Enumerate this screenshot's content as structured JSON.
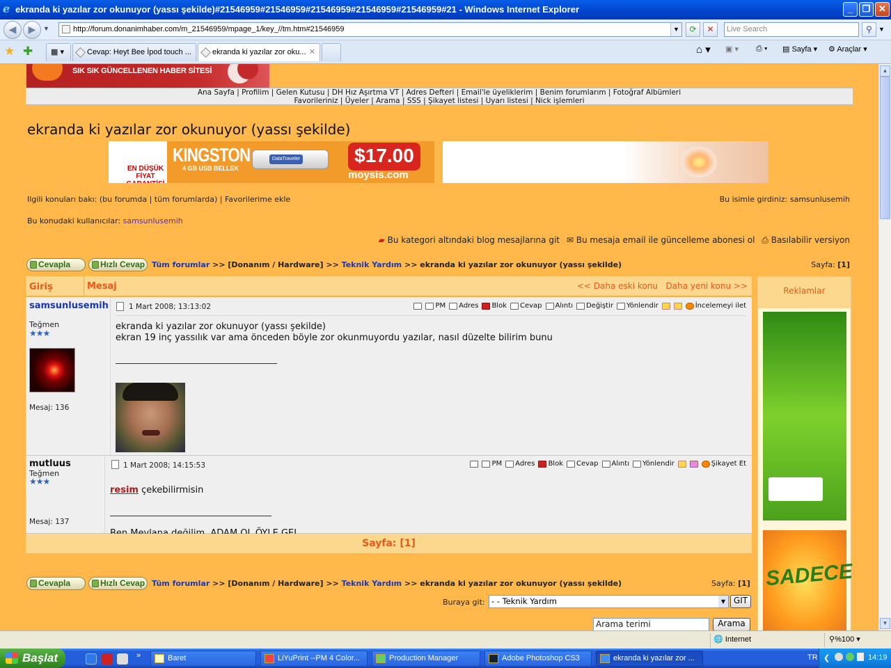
{
  "window": {
    "title": "ekranda ki yazılar zor okunuyor (yassı şekilde)#21546959#21546959#21546959#21546959#21546959#21 - Windows Internet Explorer"
  },
  "addressbar": {
    "url": "http://forum.donanimhaber.com/m_21546959/mpage_1/key_//tm.htm#21546959",
    "search_placeholder": "Live Search"
  },
  "tabs": [
    {
      "label": "Cevap: Heyt Bee İpod touch ...",
      "active": false
    },
    {
      "label": "ekranda ki yazılar zor oku...",
      "active": true
    }
  ],
  "toolbar": {
    "page_label": "Sayfa",
    "tools_label": "Araçlar"
  },
  "site": {
    "banner_slogan": "SIK SIK GÜNCELLENEN HABER SİTESİ",
    "nav_line1": "Ana Sayfa | Profilim | Gelen Kutusu | DH Hız Aşırtma VT | Adres Defteri | Email'le üyeliklerim | Benim forumlarım | Fotoğraf Albümleri",
    "nav_line2": "Favorileriniz | Üyeler | Arama | SSS | Şikayet listesi | Uyarı listesi | Nick işlemleri"
  },
  "topic": {
    "title": "ekranda ki yazılar zor okunuyor (yassı şekilde)",
    "related_prefix": "Ilgili konuları bakı:",
    "related_links": "(bu forumda | tüm forumlarda) | Favorilerime ekle",
    "logged_in_as": "Bu isimle girdiniz: samsunlusemih",
    "users_label": "Bu konudaki kullanıcılar:",
    "users_value": "samsunlusemih",
    "blog_link": "Bu kategori altındaki blog mesajlarına git",
    "email_link": "Bu mesaja email ile güncelleme abonesi ol",
    "print_link": "Basılabilir versiyon"
  },
  "ads": {
    "kingston_left": "EN DÜŞÜK FİYAT GARANTİSİ",
    "kingston_brand": "KINGSTON",
    "kingston_sub": "4 GB USB BELLEK",
    "kingston_usb": "DataTraveler",
    "kingston_price": "$17.00",
    "kingston_site": "moysis.com",
    "side_label": "Reklamlar",
    "side_orange": "SADECE"
  },
  "actions": {
    "reply": "Cevapla",
    "quick_reply": "Hızlı Cevap",
    "crumb_all": "Tüm forumlar",
    "crumb_sep": ">>",
    "crumb_cat": "[Donanım / Hardware]",
    "crumb_sub": "Teknik Yardım",
    "crumb_topic": "ekranda ki yazılar zor okunuyor (yassı şekilde)",
    "page_label": "Sayfa:",
    "page_value": "[1]"
  },
  "table": {
    "col_login": "Giriş",
    "col_message": "Mesaj",
    "older": "<< Daha eski konu",
    "newer": "Daha yeni konu >>",
    "pager": "Sayfa:   [1]"
  },
  "posts": [
    {
      "user": "samsunlusemih",
      "rank": "Teğmen",
      "stars": "★★★",
      "count": "Mesaj: 136",
      "date": "1 Mart 2008; 13:13:02",
      "line1": "ekranda ki yazılar zor okunuyor (yassı şekilde)",
      "line2": "ekran 19 inç yassılık var ama önceden böyle zor okunmuyordu yazılar, nasıl düzelte bilirim bunu",
      "tools": [
        "PM",
        "Adres",
        "Blok",
        "Cevap",
        "Alıntı",
        "Değiştir",
        "Yönlendir",
        "İncelemeyi ilet"
      ]
    },
    {
      "user": "mutluus",
      "rank": "Teğmen",
      "stars": "★★★",
      "count": "Mesaj: 137",
      "date": "1 Mart 2008; 14:15:53",
      "link_word": "resim",
      "line1_rest": " çekebilirmisin",
      "signature": "Ben Mevlana değilim, ADAM OL ÖYLE GEL...",
      "tools": [
        "PM",
        "Adres",
        "Blok",
        "Cevap",
        "Alıntı",
        "Yönlendir",
        "Şikayet Et"
      ]
    }
  ],
  "bottom": {
    "goto_label": "Buraya git:",
    "goto_value": "- - Teknik Yardım",
    "goto_button": "GIT",
    "search_placeholder": "Arama terimi",
    "search_button": "Arama"
  },
  "status": {
    "zone": "Internet",
    "zoom": "%100"
  },
  "taskbar": {
    "start": "Başlat",
    "tasks": [
      {
        "label": "Baret",
        "active": false
      },
      {
        "label": "LiYuPrint --PM 4 Color...",
        "active": false
      },
      {
        "label": "Production Manager",
        "active": false
      },
      {
        "label": "Adobe Photoshop CS3",
        "active": false
      },
      {
        "label": "ekranda ki yazılar zor ...",
        "active": true
      }
    ],
    "lang": "TR",
    "clock": "14:19"
  }
}
